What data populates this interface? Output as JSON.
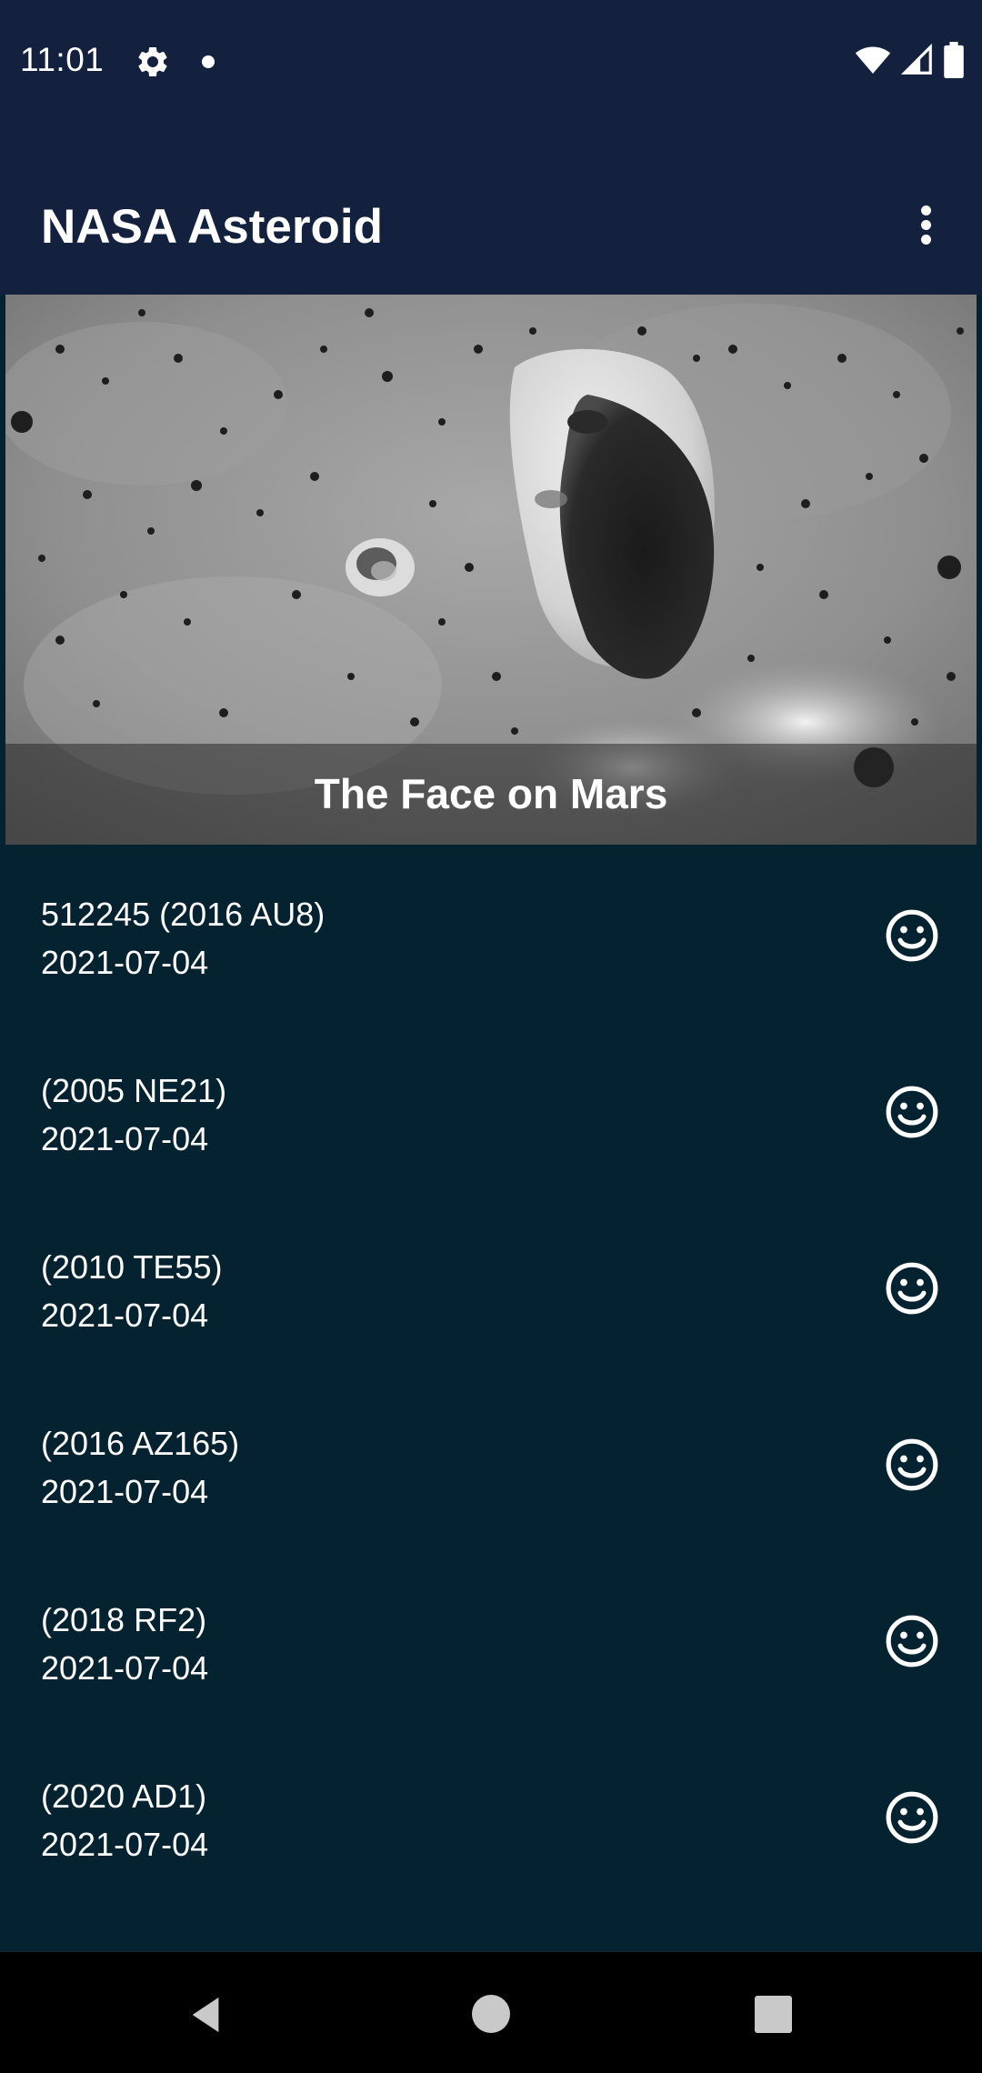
{
  "status_bar": {
    "time": "11:01",
    "icons": [
      "settings-gear-icon",
      "notification-dot-icon",
      "wifi-icon",
      "signal-icon",
      "battery-icon"
    ]
  },
  "app_bar": {
    "title": "NASA Asteroid",
    "menu_icon": "overflow-menu-icon"
  },
  "image_of_day": {
    "caption": "The Face on Mars"
  },
  "asteroids": [
    {
      "name": "512245 (2016 AU8)",
      "date": "2021-07-04",
      "icon": "smiley-icon"
    },
    {
      "name": "(2005 NE21)",
      "date": "2021-07-04",
      "icon": "smiley-icon"
    },
    {
      "name": "(2010 TE55)",
      "date": "2021-07-04",
      "icon": "smiley-icon"
    },
    {
      "name": "(2016 AZ165)",
      "date": "2021-07-04",
      "icon": "smiley-icon"
    },
    {
      "name": "(2018 RF2)",
      "date": "2021-07-04",
      "icon": "smiley-icon"
    },
    {
      "name": "(2020 AD1)",
      "date": "2021-07-04",
      "icon": "smiley-icon"
    }
  ],
  "nav_bar": {
    "buttons": [
      "back-icon",
      "home-icon",
      "recents-icon"
    ]
  },
  "colors": {
    "app_bar": "#13213f",
    "list_background": "#04222f",
    "text": "#ffffff",
    "nav_bar": "#000000"
  }
}
